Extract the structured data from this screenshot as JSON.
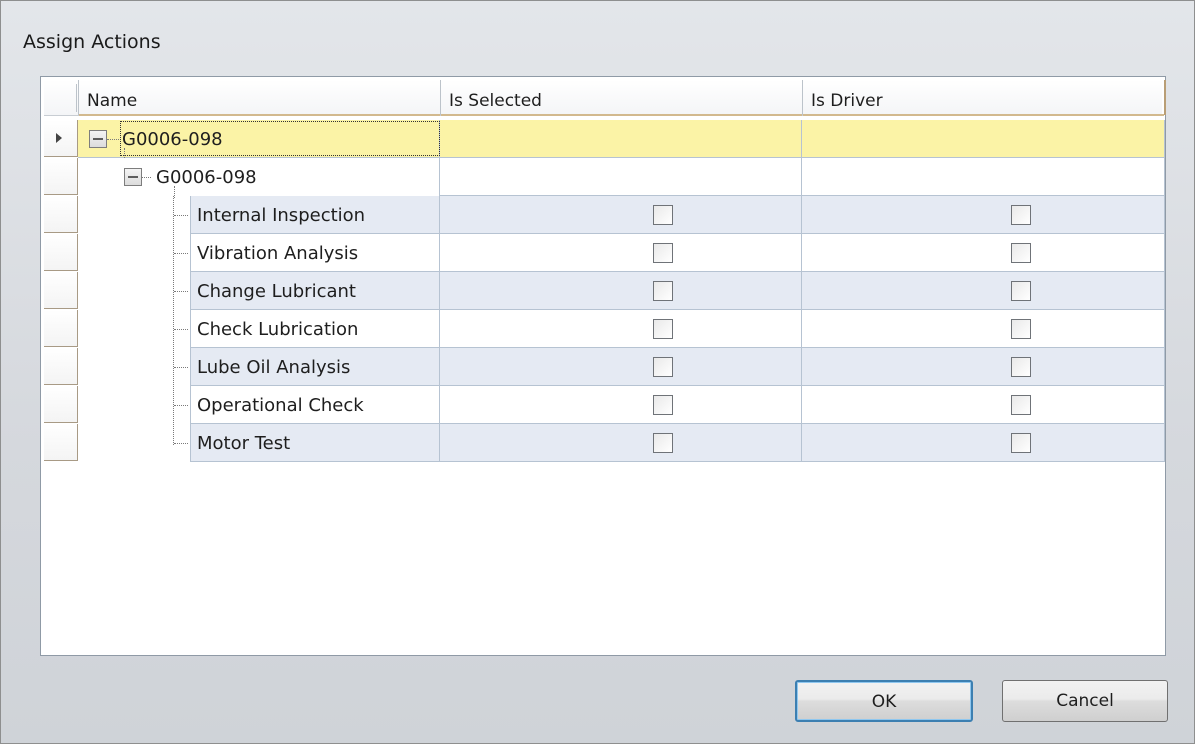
{
  "dialog": {
    "title": "Assign Actions"
  },
  "grid": {
    "columns": {
      "name": "Name",
      "selected": "Is Selected",
      "driver": "Is Driver"
    },
    "group_level_1": {
      "name": "G0006-098"
    },
    "group_level_2": {
      "name": "G0006-098"
    },
    "rows": [
      {
        "name": "Internal Inspection",
        "is_selected": false,
        "is_driver": false
      },
      {
        "name": "Vibration Analysis",
        "is_selected": false,
        "is_driver": false
      },
      {
        "name": "Change Lubricant",
        "is_selected": false,
        "is_driver": false
      },
      {
        "name": "Check Lubrication",
        "is_selected": false,
        "is_driver": false
      },
      {
        "name": "Lube Oil Analysis",
        "is_selected": false,
        "is_driver": false
      },
      {
        "name": "Operational Check",
        "is_selected": false,
        "is_driver": false
      },
      {
        "name": "Motor Test",
        "is_selected": false,
        "is_driver": false
      }
    ]
  },
  "buttons": {
    "ok": "OK",
    "cancel": "Cancel"
  },
  "colors": {
    "selected_row": "#fbf3a6",
    "alt_row": "#e5eaf3",
    "focus_border": "#3c7fb1"
  }
}
